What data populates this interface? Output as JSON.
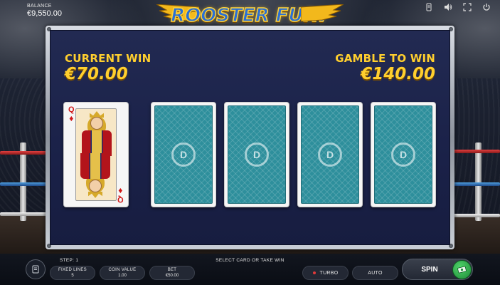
{
  "header": {
    "balance_label": "BALANCE",
    "balance_value": "€9,550.00",
    "logo_text": "ROOSTER FURY",
    "icons": [
      "info-icon",
      "sound-icon",
      "fullscreen-icon",
      "power-icon"
    ]
  },
  "gamble": {
    "current_win_label": "CURRENT WIN",
    "current_win_value": "€70.00",
    "gamble_to_win_label": "GAMBLE TO WIN",
    "gamble_to_win_value": "€140.00",
    "dealer_card": {
      "rank": "Q",
      "suit": "♦",
      "suit_name": "diamonds",
      "color": "#d11818"
    },
    "face_down_cards": 4
  },
  "footer": {
    "step_text": "STEP: 1",
    "instruction_text": "SELECT CARD OR TAKE WIN",
    "fixed_lines_label": "FIXED LINES",
    "fixed_lines_value": "5",
    "coin_value_label": "COIN VALUE",
    "coin_value_value": "1.00",
    "bet_label": "BET",
    "bet_value": "€50.00",
    "turbo_label": "TURBO",
    "auto_label": "AUTO",
    "spin_label": "SPIN"
  },
  "colors": {
    "accent_gold": "#ffcf2e",
    "panel_bg": "#1f2650",
    "card_back": "#2e8f9c",
    "collect_green": "#2fb04c"
  }
}
